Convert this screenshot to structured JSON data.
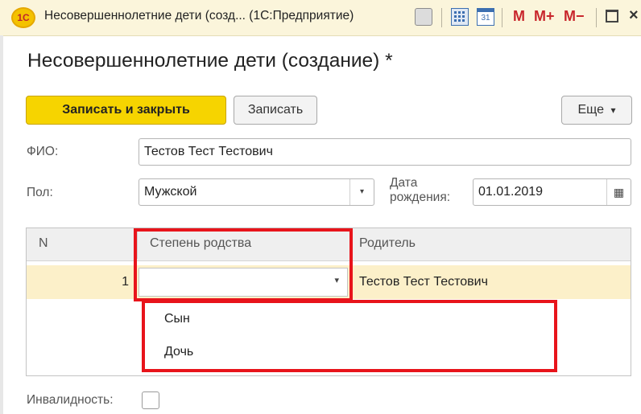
{
  "window": {
    "logo_text": "1С",
    "title": "Несовершеннолетние дети (созд... (1С:Предприятие)",
    "cal_day": "31",
    "m_label": "M",
    "m_plus_label": "M+",
    "m_minus_label": "M−",
    "close_glyph": "×"
  },
  "form": {
    "heading": "Несовершеннолетние дети (создание) *",
    "toolbar": {
      "save_close_label": "Записать и закрыть",
      "save_label": "Записать",
      "more_label": "Еще",
      "more_arrow": "▾"
    },
    "fio": {
      "label": "ФИО:",
      "value": "Тестов Тест Тестович"
    },
    "gender": {
      "label": "Пол:",
      "value": "Мужской",
      "arrow": "▾"
    },
    "birth_date": {
      "label_line1": "Дата",
      "label_line2": "рождения:",
      "value": "01.01.2019",
      "calendar_glyph": "▦"
    },
    "table": {
      "columns": [
        "N",
        "Степень родства",
        "Родитель"
      ],
      "rows": [
        {
          "n": "1",
          "relation": "",
          "parent": "Тестов Тест Тестович"
        }
      ],
      "dropdown_arrow": "▾",
      "dropdown_options": [
        "Сын",
        "Дочь"
      ]
    },
    "disability": {
      "label": "Инвалидность:",
      "checked": false
    }
  },
  "colors": {
    "primary_button": "#f6d400",
    "selected_row": "#fcf0c9",
    "annotation_red": "#e8141b",
    "titlebar": "#fbf5db"
  }
}
